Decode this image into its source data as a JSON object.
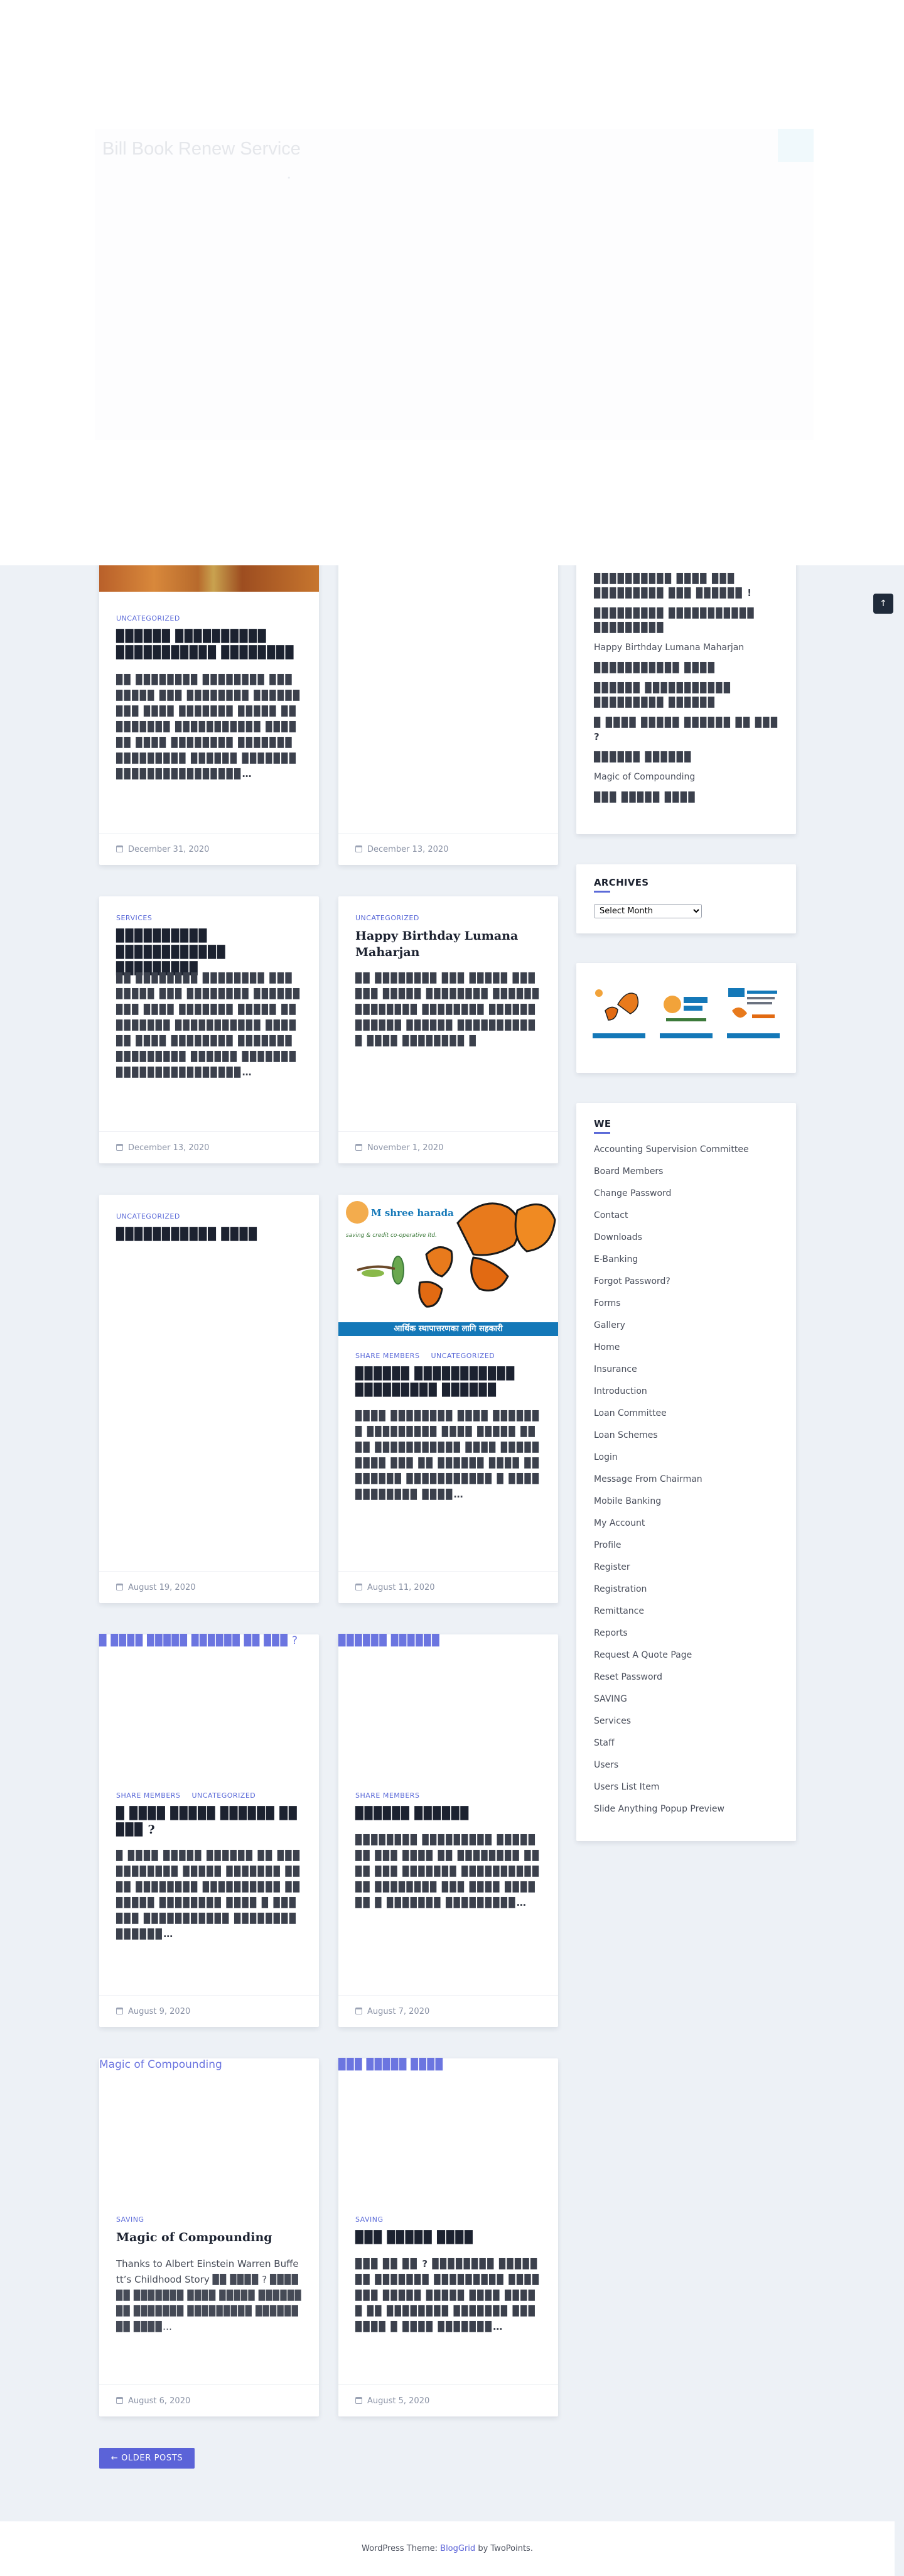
{
  "popup": {
    "title": "Bill Book Renew Service",
    "dot": "•"
  },
  "back_to_top": "↑",
  "posts": [
    {
      "categories": [
        "UNCATEGORIZED"
      ],
      "title": "▉▉▉▉▉▉ ▉▉▉▉▉▉▉▉▉▉ ▉▉▉▉▉▉▉▉▉▉▉ ▉▉▉▉▉▉▉▉",
      "excerpt": "▉▉ ▉▉▉▉▉▉▉▉ ▉▉▉▉▉▉▉▉ ▉▉▉ ▉▉▉▉▉ ▉▉▉ ▉▉▉▉▉▉▉▉ ▉▉▉▉▉▉▉▉▉ ▉▉▉▉ ▉▉▉▉▉▉▉ ▉▉▉▉▉ ▉▉▉▉▉▉▉▉▉ ▉▉▉▉▉▉▉▉▉▉▉ ▉▉▉▉▉▉ ▉▉▉▉ ▉▉▉▉▉▉▉▉ ▉▉▉▉▉▉▉ ▉▉▉▉▉▉▉▉▉ ▉▉▉▉▉▉ ▉▉▉▉▉▉▉▉▉▉▉▉▉▉▉▉▉▉▉▉▉▉▉…",
      "date": "December 31, 2020"
    },
    {
      "categories": [],
      "title": "",
      "excerpt": "",
      "date": "December 13, 2020"
    },
    {
      "categories": [
        "SERVICES"
      ],
      "title": "▉▉▉▉▉▉▉▉▉▉ ▉▉▉▉▉▉▉▉▉▉▉▉ ▉▉▉▉▉▉▉▉▉",
      "excerpt": "▉▉ ▉▉▉▉▉▉▉▉ ▉▉▉▉▉▉▉▉ ▉▉▉ ▉▉▉▉▉ ▉▉▉ ▉▉▉▉▉▉▉▉ ▉▉▉▉▉▉▉▉▉ ▉▉▉▉ ▉▉▉▉▉▉▉ ▉▉▉▉▉ ▉▉▉▉▉▉▉▉▉ ▉▉▉▉▉▉▉▉▉▉▉ ▉▉▉▉▉▉ ▉▉▉▉ ▉▉▉▉▉▉▉▉ ▉▉▉▉▉▉▉ ▉▉▉▉▉▉▉▉▉ ▉▉▉▉▉▉ ▉▉▉▉▉▉▉▉▉▉▉▉▉▉▉▉▉▉▉▉▉▉▉…",
      "date": "December 13, 2020"
    },
    {
      "categories": [
        "UNCATEGORIZED"
      ],
      "title": "Happy Birthday Lumana Maharjan",
      "excerpt": "▉▉ ▉▉▉▉▉▉▉▉ ▉▉▉ ▉▉▉▉▉ ▉▉▉▉▉▉ ▉▉▉▉▉ ▉▉▉▉▉▉▉▉ ▉▉▉▉▉▉▉▉▉▉▉▉▉▉ ▉▉▉▉▉▉▉▉ ▉▉▉▉▉▉ ▉▉▉▉▉▉ ▉▉▉▉▉▉ ▉▉▉▉▉▉▉▉▉▉▉ ▉▉▉▉ ▉▉▉▉▉▉▉▉ ▉",
      "date": "November 1, 2020"
    },
    {
      "categories": [
        "UNCATEGORIZED"
      ],
      "title": "▉▉▉▉▉▉▉▉▉▉▉ ▉▉▉▉",
      "excerpt": "",
      "date": "August 19, 2020"
    },
    {
      "categories": [
        "SHARE MEMBERS",
        "UNCATEGORIZED"
      ],
      "title": "▉▉▉▉▉▉ ▉▉▉▉▉▉▉▉▉▉▉ ▉▉▉▉▉▉▉▉▉ ▉▉▉▉▉▉",
      "excerpt": "▉▉▉▉ ▉▉▉▉▉▉▉▉ ▉▉▉▉ ▉▉▉▉▉▉▉ ▉▉▉▉▉▉▉▉▉ ▉▉▉▉ ▉▉▉▉▉ ▉▉▉▉ ▉▉▉▉▉▉▉▉▉▉▉ ▉▉▉▉ ▉▉▉▉▉▉▉▉▉ ▉▉▉ ▉▉ ▉▉▉▉▉▉ ▉▉▉▉ ▉▉ ▉▉▉▉▉▉ ▉▉▉▉▉▉▉▉▉▉▉ ▉ ▉▉▉▉▉▉▉▉▉▉▉▉ ▉▉▉▉…",
      "date": "August 11, 2020"
    },
    {
      "categories": [
        "SHARE MEMBERS",
        "UNCATEGORIZED"
      ],
      "title": "▉ ▉▉▉▉ ▉▉▉▉▉ ▉▉▉▉▉▉ ▉▉ ▉▉▉ ?",
      "excerpt": "▉ ▉▉▉▉ ▉▉▉▉▉ ▉▉▉▉▉▉ ▉▉ ▉▉▉ ▉▉▉▉▉▉▉▉ ▉▉▉▉▉ ▉▉▉▉▉▉▉ ▉▉▉▉ ▉▉▉▉▉▉▉▉ ▉▉▉▉▉▉▉▉▉▉ ▉▉▉▉▉▉▉ ▉▉▉▉▉▉▉▉ ▉▉▉▉ ▉ ▉▉▉▉▉▉ ▉▉▉▉▉▉▉▉▉▉▉ ▉▉▉▉▉▉▉▉▉▉▉▉▉▉…",
      "date": "August 9, 2020",
      "broken_image_alt": "▉ ▉▉▉▉ ▉▉▉▉▉ ▉▉▉▉▉▉ ▉▉ ▉▉▉ ?"
    },
    {
      "categories": [
        "SHARE MEMBERS"
      ],
      "title": "▉▉▉▉▉▉ ▉▉▉▉▉▉",
      "excerpt": "▉▉▉▉▉▉▉▉ ▉▉▉▉▉▉▉▉▉ ▉▉▉▉▉▉▉ ▉▉▉ ▉▉▉▉ ▉▉ ▉▉▉▉▉▉▉▉ ▉▉ ▉▉ ▉▉▉ ▉▉▉▉▉▉▉ ▉▉▉▉▉▉▉▉▉▉▉▉ ▉▉▉▉▉▉▉▉ ▉▉▉ ▉▉▉▉ ▉▉▉▉ ▉▉ ▉ ▉▉▉▉▉▉▉ ▉▉▉▉▉▉▉▉▉…",
      "date": "August 7, 2020",
      "broken_image_alt": "▉▉▉▉▉▉ ▉▉▉▉▉▉"
    },
    {
      "categories": [
        "SAVING"
      ],
      "title": "Magic of Compounding",
      "excerpt": "Thanks to Albert Einstein Warren Buffett’s Childhood Story ▉▉ ▉▉▉▉ ? ▉▉▉▉▉▉ ▉▉▉▉▉▉▉ ▉▉▉▉ ▉▉▉▉▉ ▉▉▉▉▉▉▉▉ ▉▉▉▉▉▉▉ ▉▉▉▉▉▉▉▉▉ ▉▉▉▉▉▉▉▉ ▉▉▉▉…",
      "date": "August 6, 2020",
      "broken_image_alt": "Magic of Compounding"
    },
    {
      "categories": [
        "SAVING"
      ],
      "title": "▉▉▉ ▉▉▉▉▉ ▉▉▉▉",
      "excerpt": "▉▉▉ ▉▉ ▉▉ ? ▉▉▉▉▉▉▉▉ ▉▉▉▉▉ ▉▉ ▉▉▉▉▉▉▉ ▉▉▉▉▉▉▉▉▉ ▉▉▉▉▉▉▉ ▉▉▉▉▉ ▉▉▉▉▉ ▉▉▉▉ ▉▉▉▉▉ ▉▉ ▉▉▉▉▉▉▉▉ ▉▉▉▉▉▉▉ ▉▉▉▉▉▉▉ ▉ ▉▉▉▉ ▉▉▉▉▉▉▉…",
      "date": "August 5, 2020",
      "broken_image_alt": "▉▉▉ ▉▉▉▉▉ ▉▉▉▉"
    }
  ],
  "butterfly_image": {
    "logo": "M shree harada",
    "tagline": "saving & credit co-operative ltd.",
    "banner": "आर्थिक स्थापात्तरणका लागि सहकारी"
  },
  "sidebar": {
    "recent_posts": [
      "▉▉▉▉▉▉▉▉▉▉ ▉▉▉▉ ▉▉▉ ▉▉▉▉▉▉▉▉▉ ▉▉▉ ▉▉▉▉▉▉ !",
      "▉▉▉▉▉▉▉▉▉ ▉▉▉▉▉▉▉▉▉▉▉ ▉▉▉▉▉▉▉▉▉",
      "Happy Birthday Lumana Maharjan",
      "▉▉▉▉▉▉▉▉▉▉▉ ▉▉▉▉",
      "▉▉▉▉▉▉ ▉▉▉▉▉▉▉▉▉▉▉ ▉▉▉▉▉▉▉▉▉ ▉▉▉▉▉▉",
      "▉ ▉▉▉▉ ▉▉▉▉▉ ▉▉▉▉▉▉ ▉▉ ▉▉▉ ?",
      "▉▉▉▉▉▉ ▉▉▉▉▉▉",
      "Magic of Compounding",
      "▉▉▉ ▉▉▉▉▉ ▉▉▉▉"
    ],
    "archives": {
      "title": "ARCHIVES",
      "select_value": "Select Month"
    },
    "pages": {
      "title": "WE",
      "items": [
        "Accounting Supervision Committee",
        "Board Members",
        "Change Password",
        "Contact",
        "Downloads",
        "E-Banking",
        "Forgot Password?",
        "Forms",
        "Gallery",
        "Home",
        "Insurance",
        "Introduction",
        "Loan Committee",
        "Loan Schemes",
        "Login",
        "Message From Chairman",
        "Mobile Banking",
        "My Account",
        "Profile",
        "Register",
        "Registration",
        "Remittance",
        "Reports",
        "Request A Quote Page",
        "Reset Password",
        "SAVING",
        "Services",
        "Staff",
        "Users",
        "Users List Item",
        "Slide Anything Popup Preview"
      ]
    }
  },
  "pagination": {
    "older_label": "← OLDER POSTS"
  },
  "footer": {
    "prefix": "WordPress Theme: ",
    "theme_link": "BlogGrid",
    "suffix": " by TwoPoints."
  },
  "colors": {
    "accent": "#5b63d8",
    "background": "#edf1f6",
    "banner_blue": "#1478b8"
  }
}
